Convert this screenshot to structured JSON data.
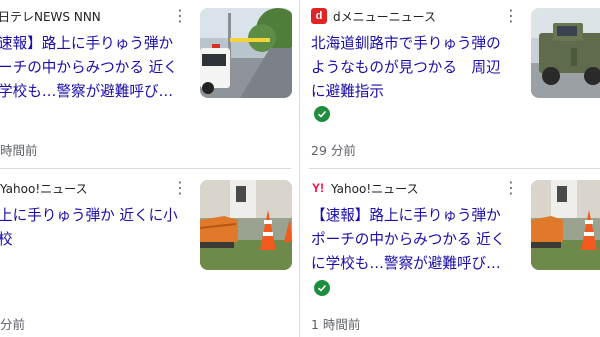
{
  "cards": [
    {
      "source": "日テレNEWS NNN",
      "headline_lines": [
        "速報】路上に手りゅう弾か",
        "ーチの中からみつかる 近く",
        "学校も…警察が避難呼び…"
      ],
      "time": "時間前",
      "verified": false
    },
    {
      "source": "dメニューニュース",
      "source_logo": "d",
      "headline_lines": [
        "北海道釧路市で手りゅう弾の",
        "ようなものが見つかる　周辺",
        "に避難指示"
      ],
      "time": "29 分前",
      "verified": true
    },
    {
      "source": "Yahoo!ニュース",
      "headline_lines": [
        "上に手りゅう弾か 近くに小",
        "校"
      ],
      "time": "分前",
      "verified": false
    },
    {
      "source": "Yahoo!ニュース",
      "source_logo": "Y!",
      "headline_lines": [
        "【速報】路上に手りゅう弾か",
        "ポーチの中からみつかる 近く",
        "に学校も…警察が避難呼び…"
      ],
      "time": "1 時間前",
      "verified": true
    }
  ],
  "icons": {
    "menu": "more-vert-icon",
    "verified": "check-circle-icon"
  },
  "colors": {
    "headline": "#1a0dab",
    "verified": "#1e8e3e",
    "yahoo": "#ff0033",
    "dmenu": "#e02424"
  }
}
